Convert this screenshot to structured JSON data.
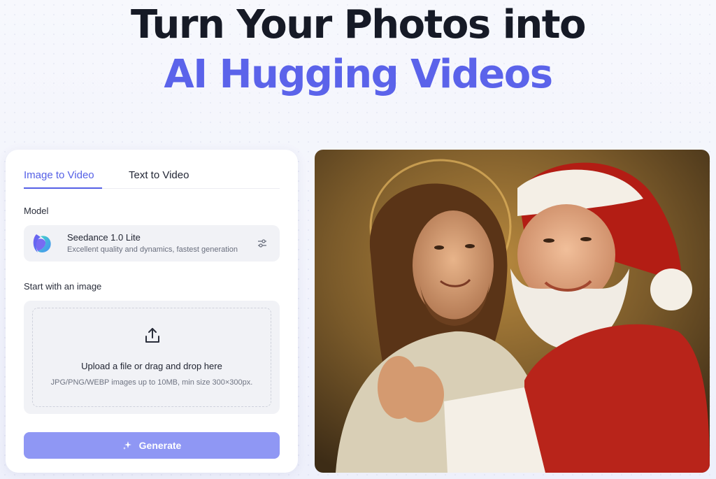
{
  "hero": {
    "title_line1": "Turn Your Photos into",
    "title_line2": "AI Hugging Videos"
  },
  "tabs": [
    {
      "label": "Image to Video",
      "active": true
    },
    {
      "label": "Text to Video",
      "active": false
    }
  ],
  "model": {
    "section_label": "Model",
    "name": "Seedance 1.0 Lite",
    "description": "Excellent quality and dynamics, fastest generation",
    "settings_icon": "sliders-icon"
  },
  "upload": {
    "section_label": "Start with an image",
    "icon": "upload-icon",
    "title": "Upload a file or drag and drop here",
    "hint": "JPG/PNG/WEBP images up to 10MB, min size 300×300px."
  },
  "generate": {
    "label": "Generate",
    "icon": "sparkle-icon"
  },
  "preview": {
    "icon": "example-hug-image"
  },
  "colors": {
    "accent": "#5b63ea",
    "generate_button": "#8f97f4",
    "title_dark": "#161a26"
  }
}
